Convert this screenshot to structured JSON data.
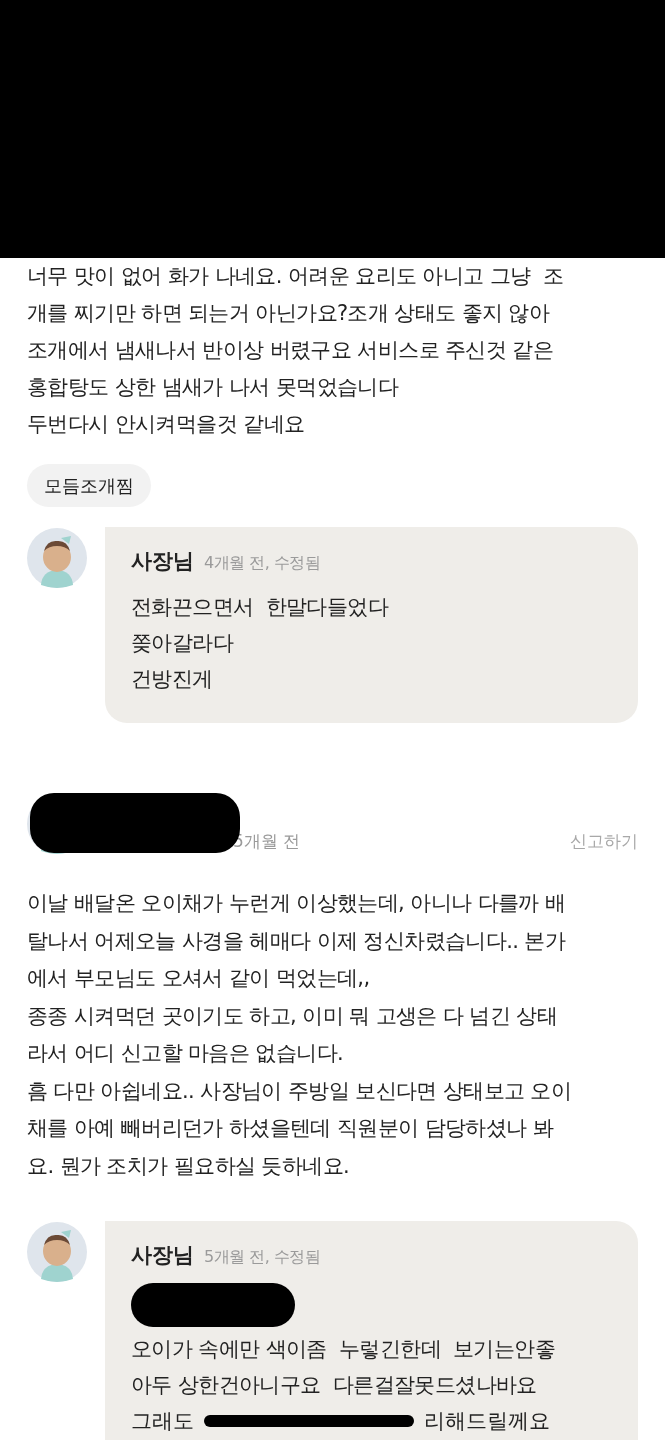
{
  "reviews": [
    {
      "redacted_header": false,
      "body_lines": [
        "너무 맛이 없어 화가 나네요. 어려운 요리도 아니고 그냥  조",
        "개를 찌기만 하면 되는거 아닌가요?조개 상태도 좋지 않아",
        "조개에서 냄새나서 반이상 버렸구요 서비스로 주신것 같은",
        "홍합탕도 상한 냄새가 나서 못먹었습니다",
        "두번다시 안시켜먹을것 같네요"
      ],
      "menu_tags": [
        "모듬조개찜"
      ],
      "owner_reply": {
        "author": "사장님",
        "time": "4개월 전, 수정됨",
        "redacted_first_line": false,
        "lines": [
          "전화끈으면서  한말다들었다",
          "쫒아갈라다",
          "건방진게"
        ]
      }
    },
    {
      "redacted_header": true,
      "time": "5개월 전",
      "report_link": "신고하기",
      "body_lines": [
        "이날 배달온 오이채가 누런게 이상했는데, 아니나 다를까 배",
        "탈나서 어제오늘 사경을 헤매다 이제 정신차렸습니다.. 본가",
        "에서 부모님도 오셔서 같이 먹었는데,,",
        "종종 시켜먹던 곳이기도 하고, 이미 뭐 고생은 다 넘긴 상태",
        "라서 어디 신고할 마음은 없습니다.",
        "흠 다만 아쉽네요.. 사장님이 주방일 보신다면 상태보고 오이",
        "채를 아예 빼버리던가 하셨을텐데 직원분이 담당하셨나 봐",
        "요. 뭔가 조치가 필요하실 듯하네요."
      ],
      "owner_reply": {
        "author": "사장님",
        "time": "5개월 전, 수정됨",
        "redacted_first_line": true,
        "lines": [
          "오이가 속에만 색이좀  누렇긴한데  보기는안좋",
          "아두 상한건아니구요  다른걸잘못드셨나바요"
        ],
        "partial_line": [
          "그래도",
          "리해드릴께요"
        ]
      }
    }
  ]
}
